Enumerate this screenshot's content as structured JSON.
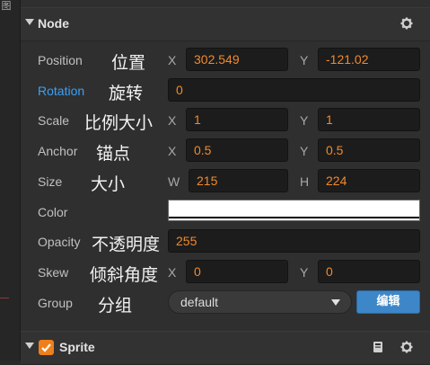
{
  "left_strip": {
    "corner_glyph": "图"
  },
  "node_section": {
    "title": "Node",
    "rows": {
      "position": {
        "label": "Position",
        "cn": "位置",
        "x_axis": "X",
        "x_value": "302.549",
        "y_axis": "Y",
        "y_value": "-121.02"
      },
      "rotation": {
        "label": "Rotation",
        "cn": "旋转",
        "value": "0"
      },
      "scale": {
        "label": "Scale",
        "cn": "比例大小",
        "x_axis": "X",
        "x_value": "1",
        "y_axis": "Y",
        "y_value": "1"
      },
      "anchor": {
        "label": "Anchor",
        "cn": "锚点",
        "x_axis": "X",
        "x_value": "0.5",
        "y_axis": "Y",
        "y_value": "0.5"
      },
      "size": {
        "label": "Size",
        "cn": "大小",
        "w_axis": "W",
        "w_value": "215",
        "h_axis": "H",
        "h_value": "224"
      },
      "color": {
        "label": "Color",
        "value_hex": "#ffffff"
      },
      "opacity": {
        "label": "Opacity",
        "cn": "不透明度",
        "value": "255"
      },
      "skew": {
        "label": "Skew",
        "cn": "倾斜角度",
        "x_axis": "X",
        "x_value": "0",
        "y_axis": "Y",
        "y_value": "0"
      },
      "group": {
        "label": "Group",
        "cn": "分组",
        "selected": "default",
        "edit_label": "编辑"
      }
    }
  },
  "sprite_section": {
    "title": "Sprite",
    "enabled": true
  },
  "colors": {
    "accent_orange": "#ef8a2d",
    "accent_blue": "#3d9ff3",
    "button_blue": "#3d87c8",
    "checkbox_orange": "#ee7f1a"
  },
  "icons": {
    "settings": "gear-icon",
    "collapse": "triangle-down-icon",
    "docs": "book-icon",
    "dropdown": "caret-down-icon",
    "check": "checkmark-icon"
  }
}
